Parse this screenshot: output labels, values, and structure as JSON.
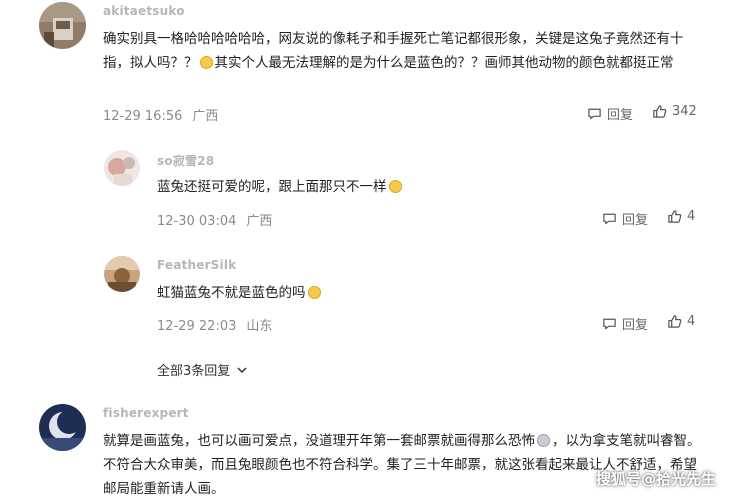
{
  "comments": [
    {
      "username": "akitaetsuko",
      "text_part1": "确实别具一格哈哈哈哈哈哈，网友说的像耗子和手握死亡笔记都很形象，关键是这兔子竟然还有十指，拟人吗？？",
      "text_part2": "其实个人最无法理解的是为什么是蓝色的？？画师其他动物的颜色就都挺正常",
      "date": "12-29 16:56",
      "location": "广西",
      "reply_label": "回复",
      "likes": "342"
    },
    {
      "username": "so寂雪28",
      "text": "蓝兔还挺可爱的呢，跟上面那只不一样",
      "date": "12-30 03:04",
      "location": "广西",
      "reply_label": "回复",
      "likes": "4"
    },
    {
      "username": "FeatherSilk",
      "text": "虹猫蓝兔不就是蓝色的吗",
      "date": "12-29 22:03",
      "location": "山东",
      "reply_label": "回复",
      "likes": "4"
    },
    {
      "username": "fisherexpert",
      "text_part1": "就算是画蓝兔，也可以画可爱点，没道理开年第一套邮票就画得那么恐怖",
      "text_part2": "，以为拿支笔就叫睿智。不符合大众审美，而且兔眼颜色也不符合科学。集了三十年邮票，就这张看起来最让人不舒适，希望邮局能重新请人画。"
    }
  ],
  "expand_label": "全部3条回复",
  "watermark": "搜狐号@拾光先生",
  "colors": {
    "username": "#b6b6b6",
    "meta": "#8a8a8a",
    "text": "#222222"
  }
}
